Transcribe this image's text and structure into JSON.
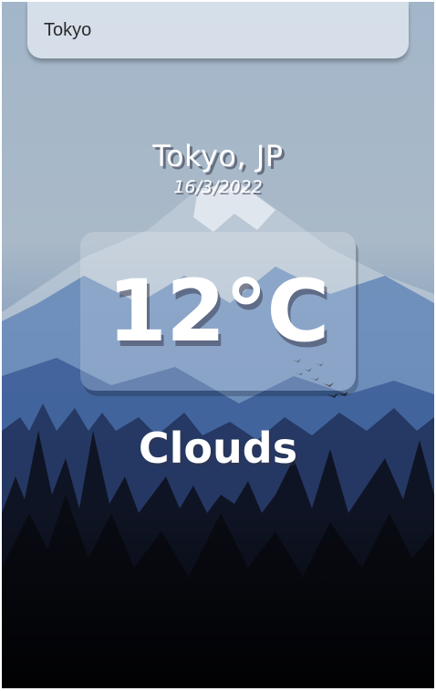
{
  "search": {
    "value": "Tokyo",
    "placeholder": "Search..."
  },
  "location": {
    "name": "Tokyo, JP",
    "date": "16/3/2022"
  },
  "weather": {
    "temperature": "12°C",
    "condition": "Clouds"
  },
  "colors": {
    "search_box_bg": "#e0e8f0",
    "text": "#ffffff",
    "sky": "#a9bcce",
    "forest": "#0b0d14"
  },
  "background": {
    "scene": "mountain-forest-illustration"
  }
}
